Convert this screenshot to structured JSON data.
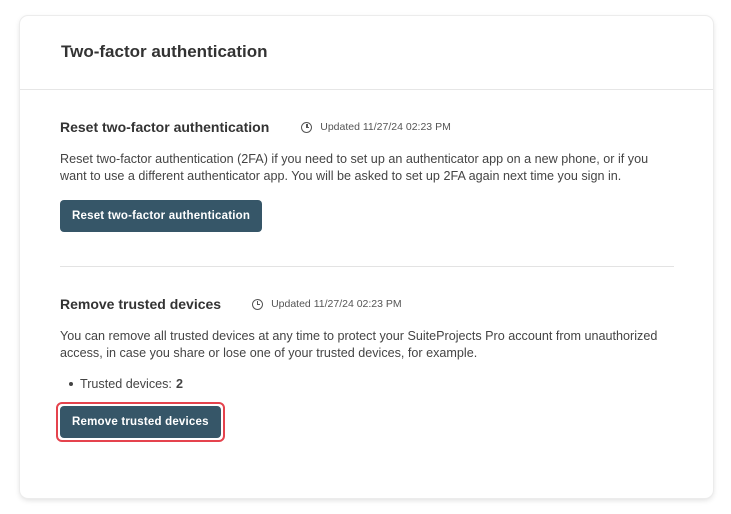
{
  "card": {
    "title": "Two-factor authentication"
  },
  "reset_section": {
    "title": "Reset two-factor authentication",
    "updated": "Updated 11/27/24 02:23 PM",
    "description": "Reset two-factor authentication (2FA) if you need to set up an authenticator app on a new phone, or if you want to use a different authenticator app. You will be asked to set up 2FA again next time you sign in.",
    "button_label": "Reset two-factor authentication"
  },
  "trusted_section": {
    "title": "Remove trusted devices",
    "updated": "Updated 11/27/24 02:23 PM",
    "description": "You can remove all trusted devices at any time to protect your SuiteProjects Pro account from unauthorized access, in case you share or lose one of your trusted devices, for example.",
    "trusted_label": "Trusted devices:",
    "trusted_count": "2",
    "button_label": "Remove trusted devices"
  },
  "icons": {
    "updated": "clock-icon"
  },
  "colors": {
    "button_bg": "#365668",
    "highlight_border": "#e5434d"
  }
}
